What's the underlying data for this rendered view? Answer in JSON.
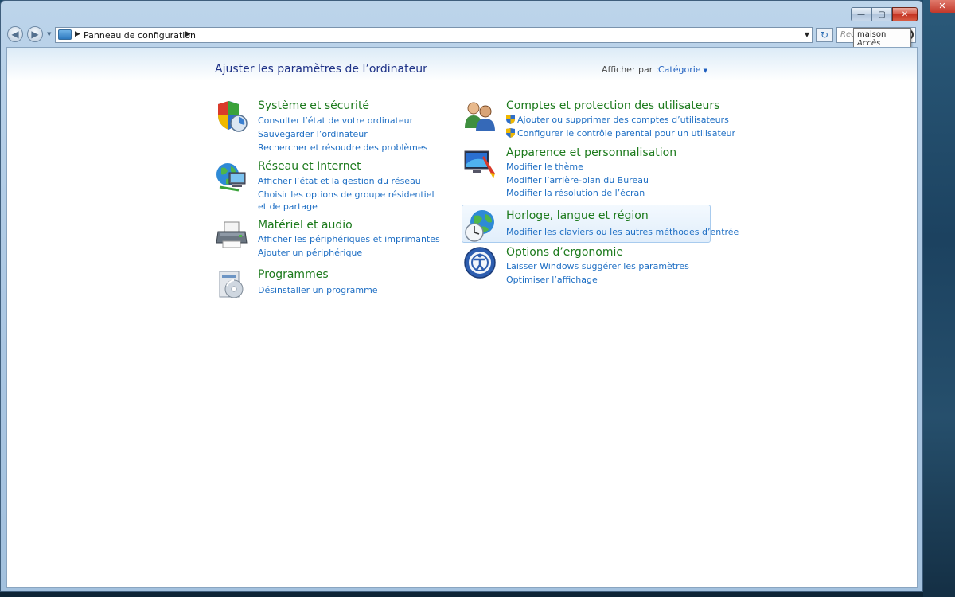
{
  "window": {
    "controls": {
      "minimize": "—",
      "maximize": "▢",
      "close": "✕"
    }
  },
  "desktop": {
    "close_glyph": "✕"
  },
  "navigation": {
    "back_glyph": "◀",
    "forward_glyph": "▶",
    "dropdown_glyph": "▼",
    "breadcrumb": "Panneau de configuration",
    "separator_glyph": "▶",
    "address_chevron": "▼",
    "refresh_glyph": "↻",
    "search_placeholder": "Rec"
  },
  "tooltip": {
    "line1": "maison",
    "line2": "Accès Internet"
  },
  "header": {
    "title": "Ajuster les paramètres de l’ordinateur",
    "view_by_label": "Afficher par :",
    "view_by_value": "Catégorie",
    "view_by_caret": "▼"
  },
  "categories": {
    "system": {
      "title": "Système et sécurité",
      "icon": "shield-icon",
      "links": [
        "Consulter l’état de votre ordinateur",
        "Sauvegarder l’ordinateur",
        "Rechercher et résoudre des problèmes"
      ]
    },
    "network": {
      "title": "Réseau et Internet",
      "icon": "network-globe-icon",
      "links": [
        "Afficher l’état et la gestion du réseau",
        "Choisir les options de groupe résidentiel et de partage"
      ]
    },
    "hardware": {
      "title": "Matériel et audio",
      "icon": "printer-icon",
      "links": [
        "Afficher les périphériques et imprimantes",
        "Ajouter un périphérique"
      ]
    },
    "programs": {
      "title": "Programmes",
      "icon": "programs-disc-icon",
      "links": [
        "Désinstaller un programme"
      ]
    },
    "users": {
      "title": "Comptes et protection des utilisateurs",
      "icon": "users-icon",
      "links": [
        "Ajouter ou supprimer des comptes d’utilisateurs",
        "Configurer le contrôle parental pour un utilisateur"
      ]
    },
    "appearance": {
      "title": "Apparence et personnalisation",
      "icon": "monitor-paint-icon",
      "links": [
        "Modifier le thème",
        "Modifier l’arrière-plan du Bureau",
        "Modifier la résolution de l’écran"
      ]
    },
    "clock": {
      "title": "Horloge, langue et région",
      "icon": "globe-clock-icon",
      "links": [
        "Modifier les claviers ou les autres méthodes d’entrée"
      ]
    },
    "ease": {
      "title": "Options d’ergonomie",
      "icon": "ease-of-access-icon",
      "links": [
        "Laisser Windows suggérer les paramètres",
        "Optimiser l’affichage"
      ]
    }
  },
  "colors": {
    "category_title": "#1c7a1c",
    "link": "#1f6fc4",
    "page_title": "#1e3287"
  }
}
